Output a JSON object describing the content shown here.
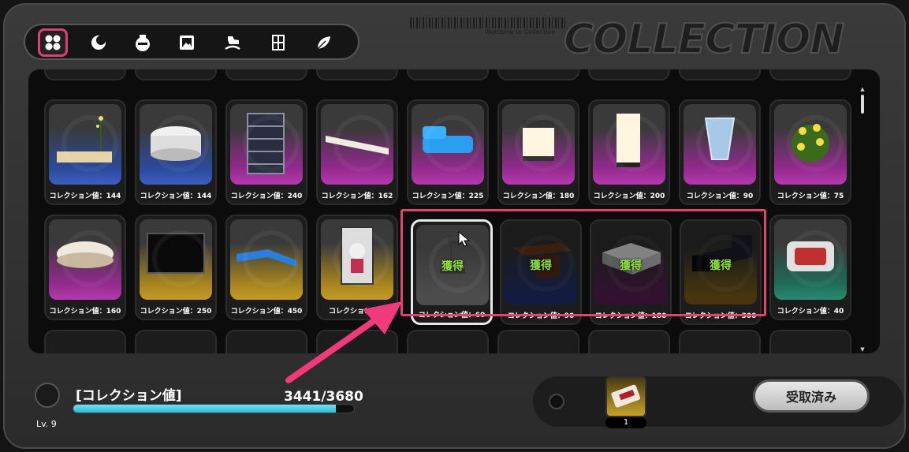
{
  "brand": {
    "title": "COLLECTION",
    "subtitle": "Welcome to Collection"
  },
  "tabs": [
    {
      "icon": "grid-icon",
      "active": true
    },
    {
      "icon": "moon-icon",
      "active": false
    },
    {
      "icon": "bowl-icon",
      "active": false
    },
    {
      "icon": "picture-icon",
      "active": false
    },
    {
      "icon": "rocking-horse-icon",
      "active": false
    },
    {
      "icon": "cabinet-icon",
      "active": false
    },
    {
      "icon": "leaf-icon",
      "active": false
    }
  ],
  "row1": [
    {
      "value": "コレクション値：144",
      "color": "blue",
      "item": "bench-with-flowers"
    },
    {
      "value": "コレクション値：144",
      "color": "blue",
      "item": "round-ottoman"
    },
    {
      "value": "コレクション値：240",
      "color": "pink",
      "item": "bookshelf"
    },
    {
      "value": "コレクション値：162",
      "color": "pink",
      "item": "long-bench"
    },
    {
      "value": "コレクション値：225",
      "color": "pink",
      "item": "blue-sofa"
    },
    {
      "value": "コレクション値：180",
      "color": "pink",
      "item": "cube-lamp"
    },
    {
      "value": "コレクション値：200",
      "color": "pink",
      "item": "tall-lamp"
    },
    {
      "value": "コレクション値：90",
      "color": "pink",
      "item": "glass-vase"
    },
    {
      "value": "コレクション値：75",
      "color": "pink",
      "item": "flower-bush"
    }
  ],
  "row2": [
    {
      "value": "コレクション値：160",
      "color": "pink",
      "item": "kidney-table"
    },
    {
      "value": "コレクション値：250",
      "color": "gold",
      "item": "tv-screen"
    },
    {
      "value": "コレクション値：450",
      "color": "gold",
      "item": "sectional-sofa"
    },
    {
      "value": "コレクション値：",
      "color": "gold",
      "item": "figure-box"
    },
    {
      "value": "コレクション値：60",
      "color": "grey",
      "item": "chair",
      "acquired": "獲得",
      "selected": true
    },
    {
      "value": "コレクション値：90",
      "color": "navy",
      "item": "desk",
      "acquired": "獲得"
    },
    {
      "value": "コレクション値：180",
      "color": "plum",
      "item": "block-table",
      "acquired": "獲得"
    },
    {
      "value": "コレクション値：300",
      "color": "amber",
      "item": "bed",
      "acquired": "獲得"
    },
    {
      "value": "コレクション値：40",
      "color": "teal",
      "item": "robot-cleaner"
    }
  ],
  "footer": {
    "level": "Lv. 9",
    "collection_label": "[コレクション値]",
    "collection_count": "3441/3680",
    "progress": 0.935,
    "reward_qty": "1",
    "claim_button": "受取済み"
  },
  "colors": {
    "accent": "#e5426f",
    "acquired": "#8fe03a",
    "progress": "#2cb8d8"
  }
}
